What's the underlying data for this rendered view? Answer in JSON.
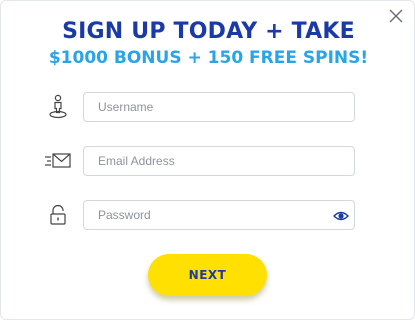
{
  "modal": {
    "headline": "SIGN UP TODAY + TAKE",
    "subheadline": "$1000 BONUS + 150 FREE SPINS!",
    "close_icon": "close-icon"
  },
  "form": {
    "username": {
      "placeholder": "Username",
      "value": "",
      "icon": "user-location-icon"
    },
    "email": {
      "placeholder": "Email Address",
      "value": "",
      "icon": "envelope-icon"
    },
    "password": {
      "placeholder": "Password",
      "value": "",
      "icon": "lock-icon",
      "toggle_icon": "eye-icon"
    }
  },
  "actions": {
    "next_label": "NEXT"
  },
  "colors": {
    "headline": "#1a3aa8",
    "subheadline": "#2aa4e8",
    "button_bg": "#ffe000",
    "button_text": "#1a3aa8"
  }
}
